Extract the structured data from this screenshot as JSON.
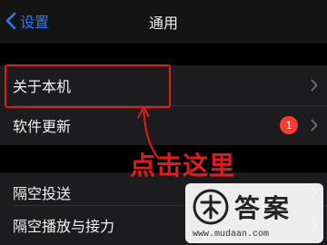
{
  "nav": {
    "back_label": "设置",
    "title": "通用",
    "back_icon": "chevron-left-icon"
  },
  "group1": {
    "items": [
      {
        "label": "关于本机",
        "icon": "chevron-right-icon"
      },
      {
        "label": "软件更新",
        "badge": "1",
        "icon": "chevron-right-icon"
      }
    ]
  },
  "group2": {
    "items": [
      {
        "label": "隔空投送",
        "icon": "chevron-right-icon"
      },
      {
        "label": "隔空播放与接力",
        "icon": "chevron-right-icon"
      }
    ]
  },
  "annotation": {
    "text": "点击这里",
    "color": "#e21b1b"
  },
  "watermark": {
    "title": "答案",
    "url": "www.mudaan.com"
  },
  "colors": {
    "accent": "#2d7cf6",
    "badge": "#ff3b30",
    "background": "#000000",
    "group": "#1c1c1e"
  }
}
